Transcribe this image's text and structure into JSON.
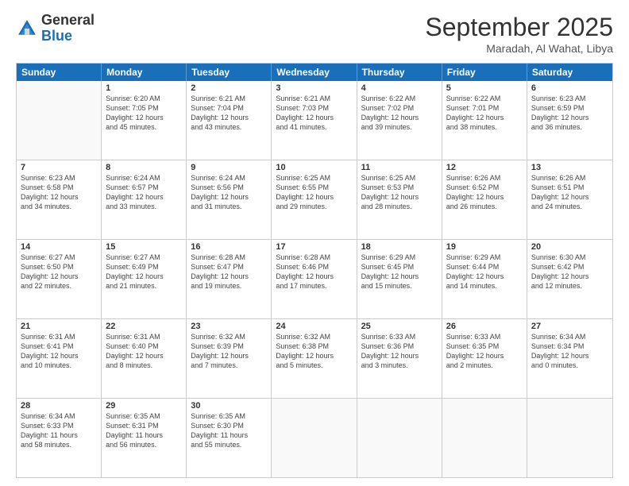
{
  "header": {
    "logo_general": "General",
    "logo_blue": "Blue",
    "month_title": "September 2025",
    "location": "Maradah, Al Wahat, Libya"
  },
  "days_of_week": [
    "Sunday",
    "Monday",
    "Tuesday",
    "Wednesday",
    "Thursday",
    "Friday",
    "Saturday"
  ],
  "weeks": [
    [
      {
        "day": "",
        "info": ""
      },
      {
        "day": "1",
        "info": "Sunrise: 6:20 AM\nSunset: 7:05 PM\nDaylight: 12 hours\nand 45 minutes."
      },
      {
        "day": "2",
        "info": "Sunrise: 6:21 AM\nSunset: 7:04 PM\nDaylight: 12 hours\nand 43 minutes."
      },
      {
        "day": "3",
        "info": "Sunrise: 6:21 AM\nSunset: 7:03 PM\nDaylight: 12 hours\nand 41 minutes."
      },
      {
        "day": "4",
        "info": "Sunrise: 6:22 AM\nSunset: 7:02 PM\nDaylight: 12 hours\nand 39 minutes."
      },
      {
        "day": "5",
        "info": "Sunrise: 6:22 AM\nSunset: 7:01 PM\nDaylight: 12 hours\nand 38 minutes."
      },
      {
        "day": "6",
        "info": "Sunrise: 6:23 AM\nSunset: 6:59 PM\nDaylight: 12 hours\nand 36 minutes."
      }
    ],
    [
      {
        "day": "7",
        "info": "Sunrise: 6:23 AM\nSunset: 6:58 PM\nDaylight: 12 hours\nand 34 minutes."
      },
      {
        "day": "8",
        "info": "Sunrise: 6:24 AM\nSunset: 6:57 PM\nDaylight: 12 hours\nand 33 minutes."
      },
      {
        "day": "9",
        "info": "Sunrise: 6:24 AM\nSunset: 6:56 PM\nDaylight: 12 hours\nand 31 minutes."
      },
      {
        "day": "10",
        "info": "Sunrise: 6:25 AM\nSunset: 6:55 PM\nDaylight: 12 hours\nand 29 minutes."
      },
      {
        "day": "11",
        "info": "Sunrise: 6:25 AM\nSunset: 6:53 PM\nDaylight: 12 hours\nand 28 minutes."
      },
      {
        "day": "12",
        "info": "Sunrise: 6:26 AM\nSunset: 6:52 PM\nDaylight: 12 hours\nand 26 minutes."
      },
      {
        "day": "13",
        "info": "Sunrise: 6:26 AM\nSunset: 6:51 PM\nDaylight: 12 hours\nand 24 minutes."
      }
    ],
    [
      {
        "day": "14",
        "info": "Sunrise: 6:27 AM\nSunset: 6:50 PM\nDaylight: 12 hours\nand 22 minutes."
      },
      {
        "day": "15",
        "info": "Sunrise: 6:27 AM\nSunset: 6:49 PM\nDaylight: 12 hours\nand 21 minutes."
      },
      {
        "day": "16",
        "info": "Sunrise: 6:28 AM\nSunset: 6:47 PM\nDaylight: 12 hours\nand 19 minutes."
      },
      {
        "day": "17",
        "info": "Sunrise: 6:28 AM\nSunset: 6:46 PM\nDaylight: 12 hours\nand 17 minutes."
      },
      {
        "day": "18",
        "info": "Sunrise: 6:29 AM\nSunset: 6:45 PM\nDaylight: 12 hours\nand 15 minutes."
      },
      {
        "day": "19",
        "info": "Sunrise: 6:29 AM\nSunset: 6:44 PM\nDaylight: 12 hours\nand 14 minutes."
      },
      {
        "day": "20",
        "info": "Sunrise: 6:30 AM\nSunset: 6:42 PM\nDaylight: 12 hours\nand 12 minutes."
      }
    ],
    [
      {
        "day": "21",
        "info": "Sunrise: 6:31 AM\nSunset: 6:41 PM\nDaylight: 12 hours\nand 10 minutes."
      },
      {
        "day": "22",
        "info": "Sunrise: 6:31 AM\nSunset: 6:40 PM\nDaylight: 12 hours\nand 8 minutes."
      },
      {
        "day": "23",
        "info": "Sunrise: 6:32 AM\nSunset: 6:39 PM\nDaylight: 12 hours\nand 7 minutes."
      },
      {
        "day": "24",
        "info": "Sunrise: 6:32 AM\nSunset: 6:38 PM\nDaylight: 12 hours\nand 5 minutes."
      },
      {
        "day": "25",
        "info": "Sunrise: 6:33 AM\nSunset: 6:36 PM\nDaylight: 12 hours\nand 3 minutes."
      },
      {
        "day": "26",
        "info": "Sunrise: 6:33 AM\nSunset: 6:35 PM\nDaylight: 12 hours\nand 2 minutes."
      },
      {
        "day": "27",
        "info": "Sunrise: 6:34 AM\nSunset: 6:34 PM\nDaylight: 12 hours\nand 0 minutes."
      }
    ],
    [
      {
        "day": "28",
        "info": "Sunrise: 6:34 AM\nSunset: 6:33 PM\nDaylight: 11 hours\nand 58 minutes."
      },
      {
        "day": "29",
        "info": "Sunrise: 6:35 AM\nSunset: 6:31 PM\nDaylight: 11 hours\nand 56 minutes."
      },
      {
        "day": "30",
        "info": "Sunrise: 6:35 AM\nSunset: 6:30 PM\nDaylight: 11 hours\nand 55 minutes."
      },
      {
        "day": "",
        "info": ""
      },
      {
        "day": "",
        "info": ""
      },
      {
        "day": "",
        "info": ""
      },
      {
        "day": "",
        "info": ""
      }
    ]
  ]
}
